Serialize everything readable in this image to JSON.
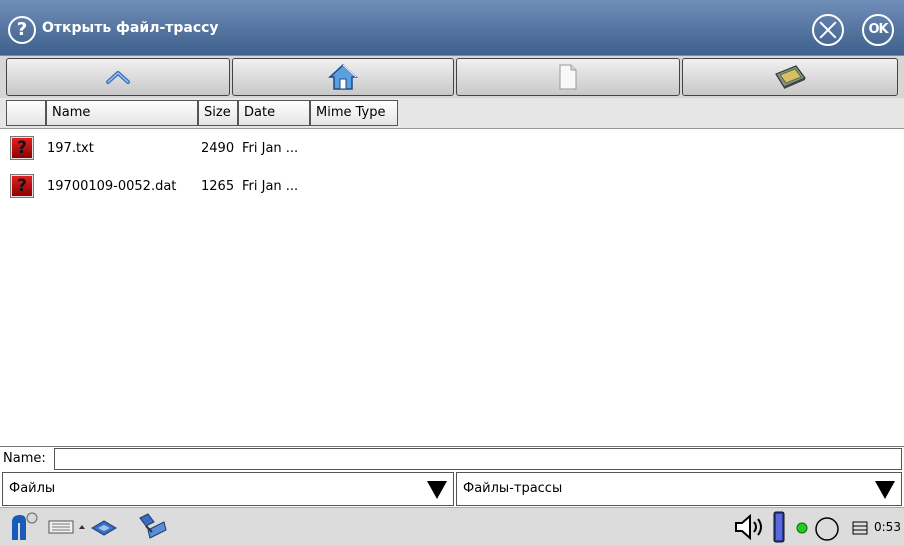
{
  "window": {
    "title": "Открыть файл-трассу",
    "help_icon": "question-circle-icon",
    "close_icon": "close-circle-icon",
    "ok_label": "OK"
  },
  "toolbar": {
    "buttons": [
      {
        "icon": "up-arrow-icon"
      },
      {
        "icon": "home-icon"
      },
      {
        "icon": "new-file-icon"
      },
      {
        "icon": "card-icon"
      }
    ]
  },
  "table": {
    "columns": [
      "Name",
      "Size",
      "Date",
      "Mime Type"
    ],
    "rows": [
      {
        "icon": "unknown-file-icon",
        "name": "197.txt",
        "size": "2490",
        "date": "Fri Jan ..."
      },
      {
        "icon": "unknown-file-icon",
        "name": "19700109-0052.dat",
        "size": "1265",
        "date": "Fri Jan ..."
      }
    ]
  },
  "name_field": {
    "label": "Name:",
    "value": ""
  },
  "combos": {
    "location": "Файлы",
    "filter": "Файлы-трассы"
  },
  "taskbar": {
    "clock": "0:53"
  },
  "colors": {
    "titlebar": "#4a6a98",
    "error_icon": "#c01010"
  }
}
